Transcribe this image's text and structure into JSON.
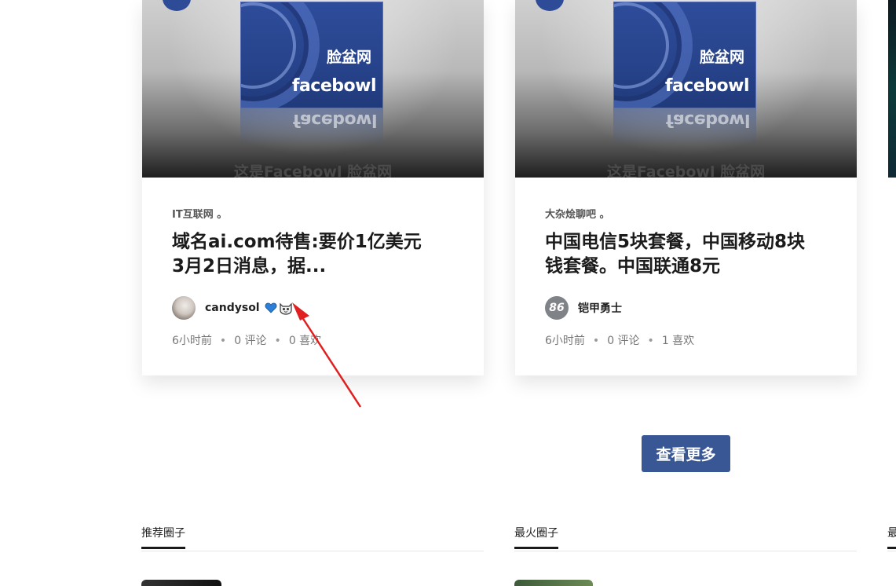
{
  "cards": [
    {
      "image": {
        "cn_text": "脸盆网",
        "en_text": "facebowl",
        "caption": "这是Facebowl 脸盆网"
      },
      "category": "IT互联网 。",
      "title_line1": "域名ai.com待售:要价1亿美元",
      "title_line2": "3月2日消息，据...",
      "author": "candysol",
      "author_avatar_icon": "user-photo-avatar",
      "author_badges": [
        "blue-heart-icon",
        "cat-face-icon"
      ],
      "time": "6小时前",
      "comments": "0 评论",
      "likes": "0 喜欢"
    },
    {
      "image": {
        "cn_text": "脸盆网",
        "en_text": "facebowl",
        "caption": "这是Facebowl 脸盆网"
      },
      "category": "大杂烩聊吧 。",
      "title_line1": "中国电信5块套餐，中国移动8块",
      "title_line2": "钱套餐。中国联通8元",
      "author": "铠甲勇士",
      "author_avatar_text": "86",
      "time": "6小时前",
      "comments": "0 评论",
      "likes": "1 喜欢"
    }
  ],
  "load_more_label": "查看更多",
  "sections": {
    "recommended": "推荐圈子",
    "hottest": "最火圈子",
    "third": "最"
  },
  "colors": {
    "button": "#3a5795",
    "annotation_arrow": "#e02020",
    "logo_blue": "#2d4c9a"
  }
}
